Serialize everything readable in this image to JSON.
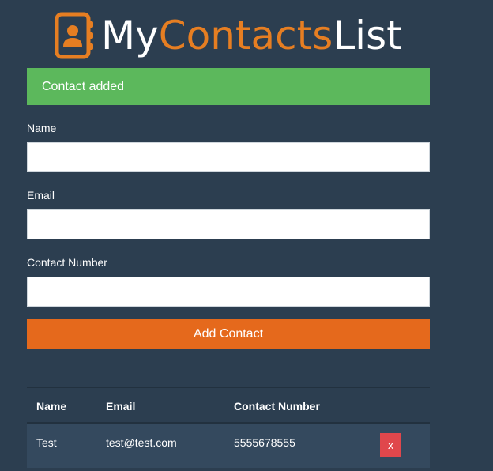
{
  "header": {
    "logo_icon": "contact-book-icon",
    "title_part1": "My",
    "title_part2": "Contacts",
    "title_part3": "List",
    "accent_color": "#e67e22"
  },
  "alert": {
    "message": "Contact added",
    "color": "#5cb85c"
  },
  "form": {
    "name_label": "Name",
    "name_value": "",
    "email_label": "Email",
    "email_value": "",
    "number_label": "Contact Number",
    "number_value": "",
    "submit_label": "Add Contact",
    "submit_color": "#e5691c"
  },
  "table": {
    "headers": [
      "Name",
      "Email",
      "Contact Number"
    ],
    "rows": [
      {
        "name": "Test",
        "email": "test@test.com",
        "number": "5555678555",
        "delete_label": "x"
      }
    ],
    "delete_color": "#e0474c"
  }
}
